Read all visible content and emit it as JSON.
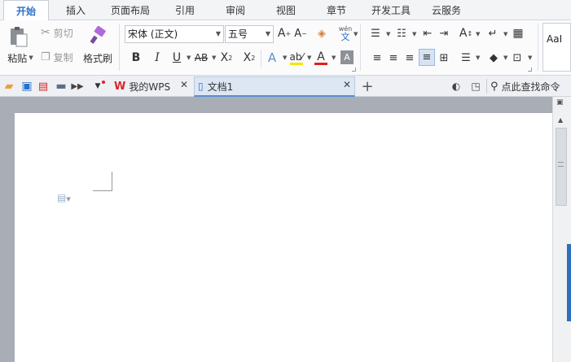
{
  "menu": {
    "tabs": [
      "开始",
      "插入",
      "页面布局",
      "引用",
      "审阅",
      "视图",
      "章节",
      "开发工具",
      "云服务"
    ],
    "active": "开始"
  },
  "clipboard": {
    "paste": "粘贴",
    "cut": "剪切",
    "copy": "复制",
    "format_painter": "格式刷"
  },
  "font": {
    "name": "宋体 (正文)",
    "size": "五号"
  },
  "styles": {
    "preview": "AaI"
  },
  "tabs": {
    "wps_tab": "我的WPS",
    "doc_tab": "文档1",
    "find_command": "点此查找命令"
  },
  "colors": {
    "accent": "#2a6fc9",
    "font_color_bar": "#e02020",
    "highlight_bar": "#f5e400",
    "wps_red": "#d9262c"
  }
}
